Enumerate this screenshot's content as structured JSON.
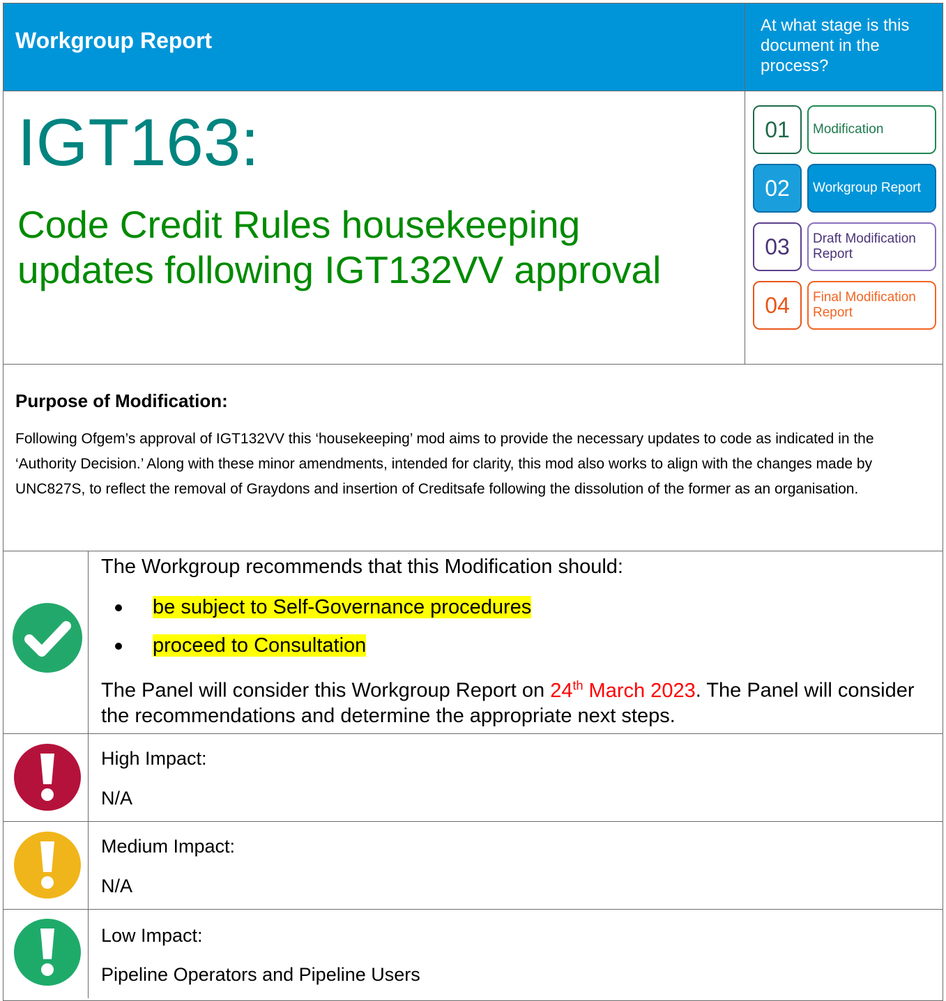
{
  "header": {
    "title": "Workgroup Report",
    "stage_question": "At what stage is this document in the process?"
  },
  "modification": {
    "id": "IGT163:",
    "title": "Code Credit Rules housekeeping updates following IGT132VV approval"
  },
  "stages": [
    {
      "num": "01",
      "label": "Modification",
      "color": "#1f7a4d"
    },
    {
      "num": "02",
      "label": "Workgroup Report",
      "color": "#0095d9"
    },
    {
      "num": "03",
      "label": "Draft Modification Report",
      "color": "#5b3f8c"
    },
    {
      "num": "04",
      "label": "Final Modification Report",
      "color": "#f26522"
    }
  ],
  "purpose": {
    "heading": "Purpose of Modification:",
    "text": "Following Ofgem’s approval of IGT132VV this ‘housekeeping’ mod aims to provide the necessary updates to code as indicated in the ‘Authority Decision.’ Along with these minor amendments, intended for clarity, this mod also works to align with the changes made by UNC827S, to reflect the removal of Graydons and insertion of Creditsafe following the dissolution of the former as an organisation."
  },
  "recommendation": {
    "intro": "The Workgroup recommends that this Modification should:",
    "bullets": [
      "be subject to Self-Governance procedures",
      "proceed to Consultation"
    ],
    "panel_prefix": "The Panel will consider this Workgroup Report on ",
    "panel_day": "24",
    "panel_day_suffix": "th",
    "panel_date_rest": " March 2023",
    "panel_suffix": ".  The Panel will consider the recommendations and determine the appropriate next steps."
  },
  "impacts": {
    "high": {
      "label": "High Impact:",
      "value": "N/A",
      "color": "#b5123b"
    },
    "medium": {
      "label": "Medium Impact:",
      "value": "N/A",
      "color": "#f0b51a"
    },
    "low": {
      "label": "Low Impact:",
      "value": "Pipeline Operators and Pipeline Users",
      "color": "#1eab6a"
    }
  },
  "colors": {
    "header_bg": "#0095d9",
    "id_teal": "#00847f",
    "title_green": "#008a00",
    "check_green": "#23a86b"
  }
}
